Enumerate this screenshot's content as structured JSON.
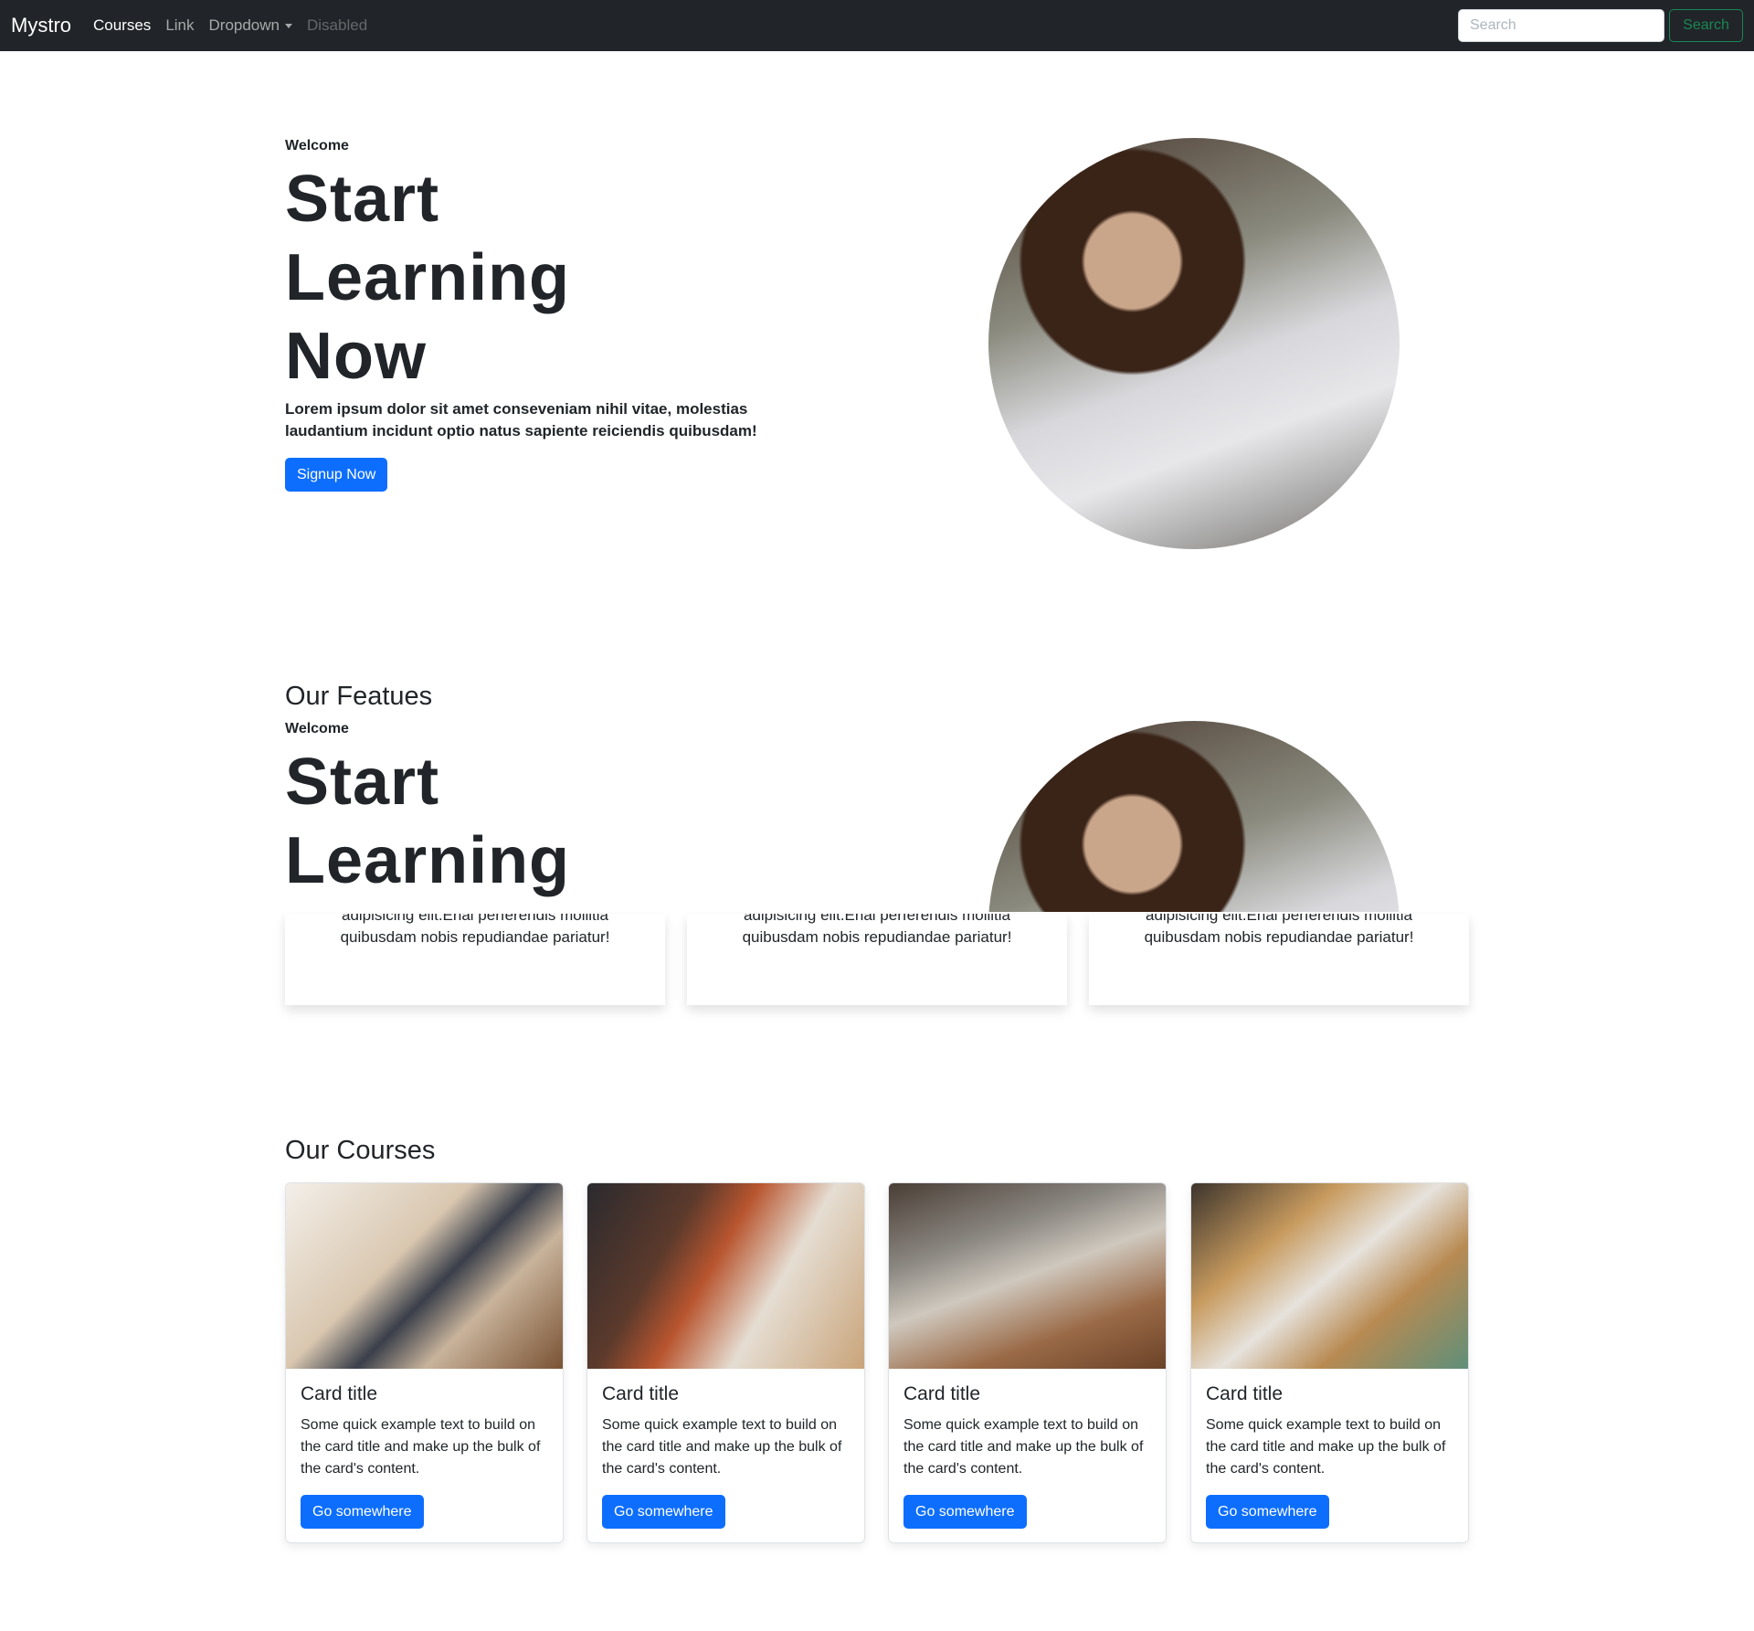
{
  "nav": {
    "brand": "Mystro",
    "links": [
      "Courses",
      "Link",
      "Dropdown",
      "Disabled"
    ],
    "search_placeholder": "Search",
    "search_button": "Search"
  },
  "hero": {
    "eyebrow": "Welcome",
    "title": [
      "Start",
      "Learning",
      "Now"
    ],
    "text": "Lorem ipsum dolor sit amet conseveniam nihil vitae, molestias laudantium incidunt optio natus sapiente reiciendis quibusdam!",
    "button": "Signup Now"
  },
  "features": {
    "heading": "Our Featues",
    "eyebrow": "Welcome",
    "title": [
      "Start",
      "Learning"
    ],
    "cards": [
      {
        "line1": "adipisicing elit.Enal perferendis mollitia",
        "line2": "quibusdam nobis repudiandae pariatur!"
      },
      {
        "line1": "adipisicing elit.Enal perferendis mollitia",
        "line2": "quibusdam nobis repudiandae pariatur!"
      },
      {
        "line1": "adipisicing elit.Enal perferendis mollitia",
        "line2": "quibusdam nobis repudiandae pariatur!"
      }
    ]
  },
  "courses": {
    "heading": "Our Courses",
    "cards": [
      {
        "title": "Card title",
        "text": "Some quick example text to build on the card title and make up the bulk of the card's content.",
        "button": "Go somewhere"
      },
      {
        "title": "Card title",
        "text": "Some quick example text to build on the card title and make up the bulk of the card's content.",
        "button": "Go somewhere"
      },
      {
        "title": "Card title",
        "text": "Some quick example text to build on the card title and make up the bulk of the card's content.",
        "button": "Go somewhere"
      },
      {
        "title": "Card title",
        "text": "Some quick example text to build on the card title and make up the bulk of the card's content.",
        "button": "Go somewhere"
      }
    ]
  }
}
